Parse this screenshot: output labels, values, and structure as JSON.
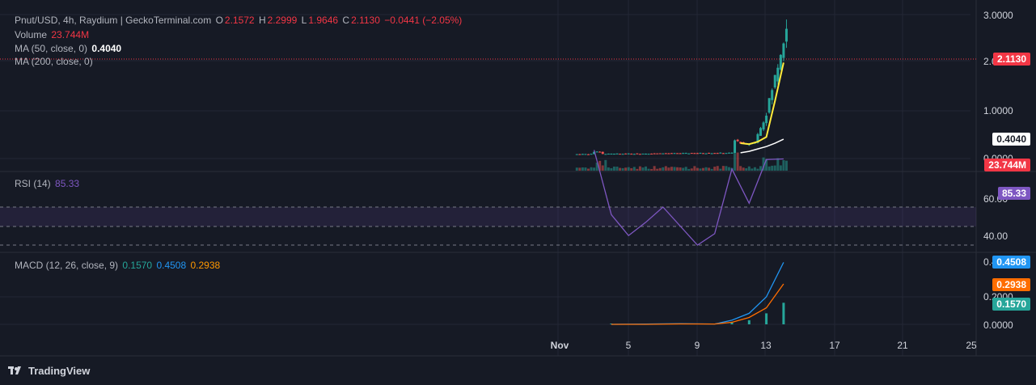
{
  "header": {
    "symbol": "Pnut/USD, 4h, Raydium | GeckoTerminal.com",
    "o_label": "O",
    "o": "2.1572",
    "h_label": "H",
    "h": "2.2999",
    "l_label": "L",
    "l": "1.9646",
    "c_label": "C",
    "c": "2.1130",
    "change": "−0.0441 (−2.05%)"
  },
  "volume": {
    "label": "Volume",
    "value": "23.744M"
  },
  "ma50": {
    "label": "MA (50, close, 0)",
    "value": "0.4040"
  },
  "ma200": {
    "label": "MA (200, close, 0)"
  },
  "rsi": {
    "label": "RSI (14)",
    "value": "85.33"
  },
  "macd": {
    "label": "MACD (12, 26, close, 9)",
    "hist": "0.1570",
    "macd": "0.4508",
    "signal": "0.2938"
  },
  "price_axis": [
    "3.0000",
    "2.0000",
    "1.0000",
    "0.0000"
  ],
  "rsi_axis": [
    "60.00",
    "40.00"
  ],
  "macd_axis": [
    "0.4000",
    "0.2000",
    "0.0000"
  ],
  "tags": {
    "price": "2.1130",
    "ma": "0.4040",
    "volume": "23.744M",
    "rsi": "85.33",
    "macd": "0.4508",
    "signal": "0.2938",
    "hist": "0.1570"
  },
  "x_axis": [
    "Nov",
    "5",
    "9",
    "13",
    "17",
    "21",
    "25"
  ],
  "footer": {
    "brand": "TradingView"
  },
  "colors": {
    "up": "#26a69a",
    "down": "#ef5350",
    "ma50": "#ffeb3b",
    "ma200": "#ffffff",
    "rsi": "#7e57c2",
    "macd": "#2196f3",
    "signal": "#ff6d00"
  },
  "chart_data": [
    {
      "type": "line",
      "title": "Pnut/USD, 4h, Raydium",
      "x": [
        "Nov 2",
        "Nov 3",
        "Nov 4",
        "Nov 5",
        "Nov 6",
        "Nov 7",
        "Nov 8",
        "Nov 9",
        "Nov 10",
        "Nov 11",
        "Nov 11.5",
        "Nov 12",
        "Nov 12.5",
        "Nov 13",
        "Nov 13.5",
        "Nov 14"
      ],
      "series": [
        {
          "values": [
            0.01,
            0.12,
            0.07,
            0.06,
            0.07,
            0.09,
            0.1,
            0.09,
            0.11,
            0.15,
            0.45,
            0.38,
            0.42,
            0.55,
            1.5,
            2.113
          ]
        },
        {
          "name": "MA (50, close, 0)",
          "values": [
            null,
            null,
            null,
            null,
            null,
            null,
            null,
            null,
            null,
            null,
            0.32,
            0.3,
            0.35,
            0.45,
            1.2,
            2.0
          ]
        },
        {
          "name": "MA (200, close, 0)",
          "values": [
            null,
            null,
            null,
            null,
            null,
            null,
            null,
            null,
            null,
            null,
            0.12,
            0.15,
            0.2,
            0.25,
            0.32,
            0.404
          ]
        }
      ],
      "ylim": [
        0,
        3
      ]
    },
    {
      "type": "line",
      "title": "RSI (14)",
      "x": [
        "Nov 3",
        "Nov 4",
        "Nov 5",
        "Nov 6",
        "Nov 7",
        "Nov 8",
        "Nov 9",
        "Nov 10",
        "Nov 11",
        "Nov 12",
        "Nov 13",
        "Nov 14"
      ],
      "series": [
        {
          "name": "RSI (14)",
          "values": [
            90,
            56,
            45,
            52,
            60,
            50,
            40,
            46,
            80,
            62,
            85,
            85.33
          ]
        }
      ],
      "ylim": [
        30,
        100
      ]
    },
    {
      "type": "line",
      "title": "MACD (12, 26, close, 9)",
      "x": [
        "Nov 4",
        "Nov 6",
        "Nov 8",
        "Nov 10",
        "Nov 11",
        "Nov 12",
        "Nov 13",
        "Nov 14"
      ],
      "series": [
        {
          "name": "MACD",
          "values": [
            0.0,
            0.002,
            0.005,
            0.002,
            0.03,
            0.08,
            0.2,
            0.4508
          ]
        },
        {
          "name": "Signal",
          "values": [
            0.0,
            0.0,
            0.003,
            0.002,
            0.015,
            0.05,
            0.12,
            0.2938
          ]
        },
        {
          "name": "Histogram",
          "values": [
            0.0,
            0.002,
            0.002,
            0.0,
            0.015,
            0.03,
            0.08,
            0.157
          ]
        }
      ],
      "ylim": [
        0,
        0.5
      ]
    }
  ]
}
